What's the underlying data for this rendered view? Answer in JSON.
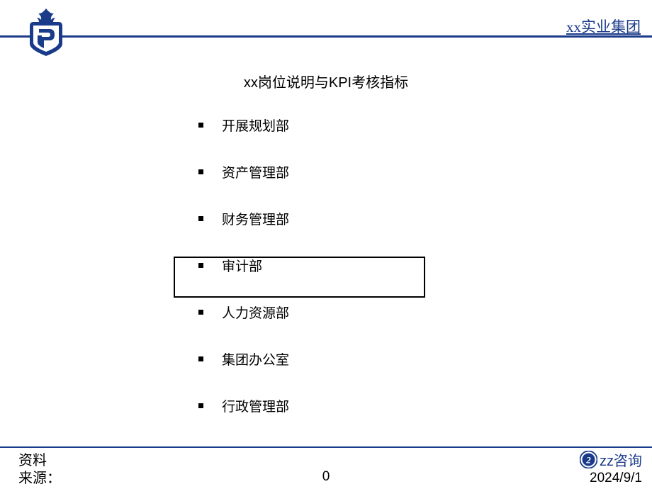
{
  "header": {
    "companyName": "xx实业集团"
  },
  "title": "xx岗位说明与KPI考核指标",
  "bullets": {
    "item0": "开展规划部",
    "item1": "资产管理部",
    "item2": "财务管理部",
    "item3": "审计部",
    "item4": "人力资源部",
    "item5": "集团办公室",
    "item6": "行政管理部"
  },
  "footer": {
    "sourceLabel": "资料\n来源：",
    "pageNumber": "0",
    "consultingLabel": "zz咨询",
    "date": "2024/9/1"
  }
}
